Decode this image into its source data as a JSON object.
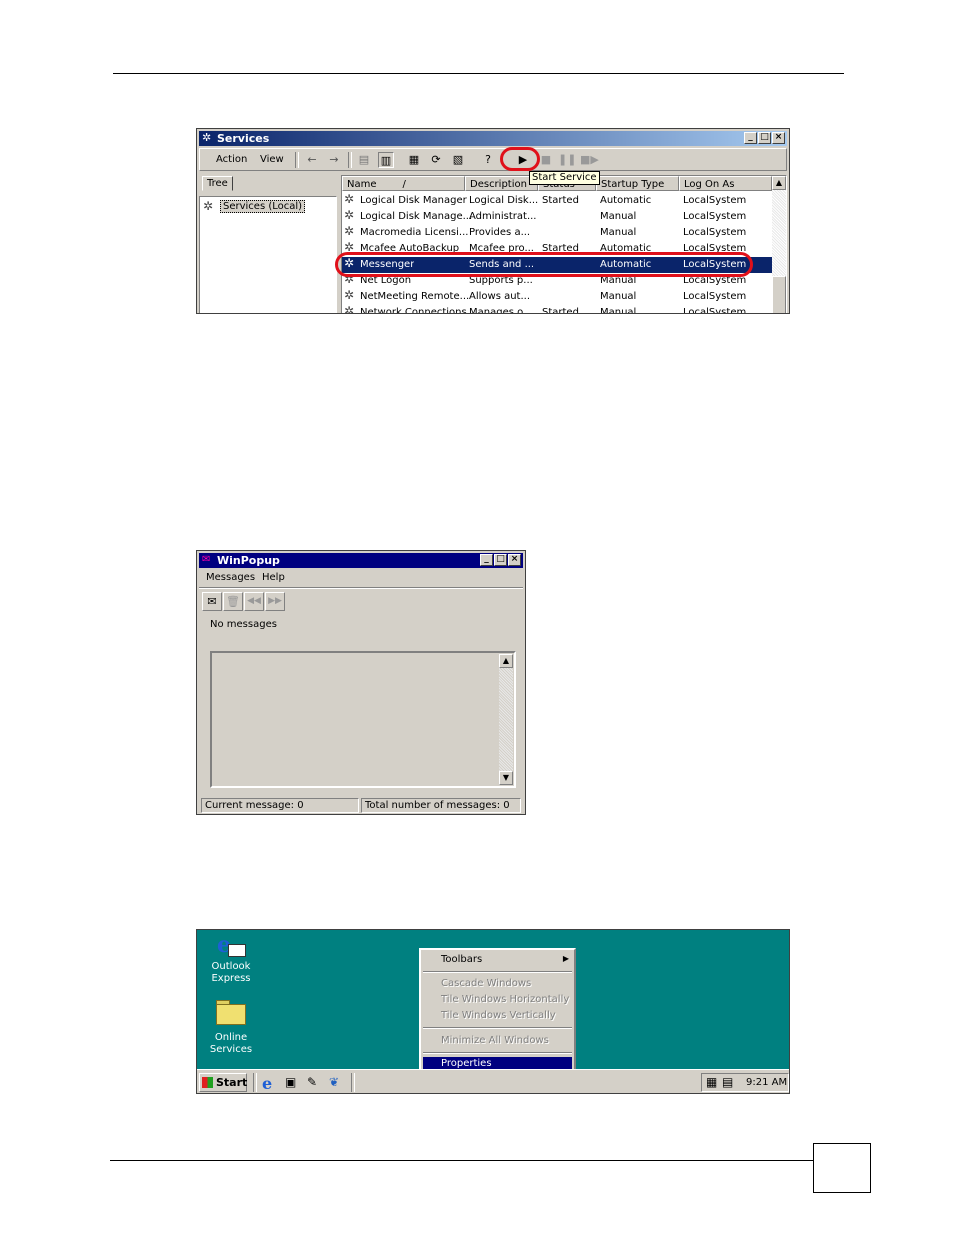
{
  "services": {
    "title": "Services",
    "menu": [
      "Action",
      "View"
    ],
    "tree_label": "Tree",
    "tree_item": "Services (Local)",
    "tooltip": "Start Service",
    "columns": [
      "Name",
      "Description",
      "Status",
      "Startup Type",
      "Log On As"
    ],
    "rows": [
      {
        "name": "Logical Disk Manager",
        "desc": "Logical Disk...",
        "status": "Started",
        "startup": "Automatic",
        "logon": "LocalSystem"
      },
      {
        "name": "Logical Disk Manage...",
        "desc": "Administrat...",
        "status": "",
        "startup": "Manual",
        "logon": "LocalSystem"
      },
      {
        "name": "Macromedia Licensi...",
        "desc": "Provides a...",
        "status": "",
        "startup": "Manual",
        "logon": "LocalSystem"
      },
      {
        "name": "Mcafee AutoBackup",
        "desc": "Mcafee pro...",
        "status": "Started",
        "startup": "Automatic",
        "logon": "LocalSystem"
      },
      {
        "name": "Messenger",
        "desc": "Sends and ...",
        "status": "",
        "startup": "Automatic",
        "logon": "LocalSystem"
      },
      {
        "name": "Net Logon",
        "desc": "Supports p...",
        "status": "",
        "startup": "Manual",
        "logon": "LocalSystem"
      },
      {
        "name": "NetMeeting Remote...",
        "desc": "Allows aut...",
        "status": "",
        "startup": "Manual",
        "logon": "LocalSystem"
      },
      {
        "name": "Network Connections",
        "desc": "Manages o...",
        "status": "Started",
        "startup": "Manual",
        "logon": "LocalSystem"
      }
    ],
    "highlight_color": "#e0101a"
  },
  "winpopup": {
    "title": "WinPopup",
    "menu": [
      "Messages",
      "Help"
    ],
    "no_messages": "No messages",
    "status_current": "Current message: 0",
    "status_total": "Total number of messages: 0"
  },
  "desktop": {
    "icons": [
      {
        "line1": "Outlook",
        "line2": "Express"
      },
      {
        "line1": "Online",
        "line2": "Services"
      }
    ],
    "context_menu": [
      "Toolbars",
      "Cascade Windows",
      "Tile Windows Horizontally",
      "Tile Windows Vertically",
      "Minimize All Windows",
      "Properties"
    ],
    "start_label": "Start",
    "clock": "9:21 AM",
    "background_color": "#008080"
  }
}
